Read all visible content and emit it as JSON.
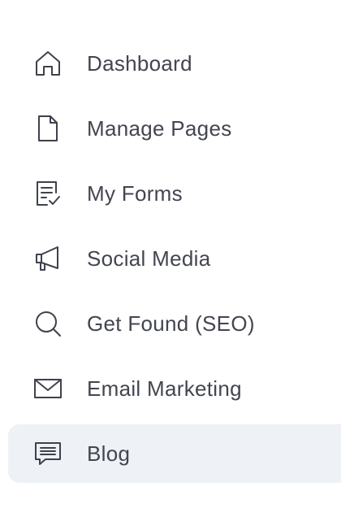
{
  "sidebar": {
    "items": [
      {
        "label": "Dashboard",
        "icon": "home-icon",
        "active": false
      },
      {
        "label": "Manage Pages",
        "icon": "page-icon",
        "active": false
      },
      {
        "label": "My Forms",
        "icon": "form-check-icon",
        "active": false
      },
      {
        "label": "Social Media",
        "icon": "megaphone-icon",
        "active": false
      },
      {
        "label": "Get Found (SEO)",
        "icon": "search-icon",
        "active": false
      },
      {
        "label": "Email Marketing",
        "icon": "envelope-icon",
        "active": false
      },
      {
        "label": "Blog",
        "icon": "chat-lines-icon",
        "active": true
      }
    ]
  },
  "colors": {
    "text": "#434550",
    "icon": "#3f414d",
    "active_background": "#eef1f6"
  }
}
